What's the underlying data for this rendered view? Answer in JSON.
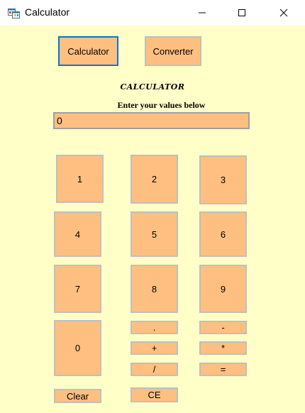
{
  "window": {
    "title": "Calculator"
  },
  "tabs": {
    "calculator": "Calculator",
    "converter": "Converter"
  },
  "heading": "CALCULATOR",
  "subheading": "Enter your values below",
  "display": {
    "value": "0"
  },
  "keys": {
    "k1": "1",
    "k2": "2",
    "k3": "3",
    "k4": "4",
    "k5": "5",
    "k6": "6",
    "k7": "7",
    "k8": "8",
    "k9": "9",
    "k0": "0",
    "dot": ".",
    "plus": "+",
    "divide": "/",
    "minus": "-",
    "multiply": "*",
    "equals": "=",
    "clear": "Clear",
    "ce": "CE"
  },
  "colors": {
    "background": "#ffffc8",
    "button": "#ffbf80",
    "focus": "#0078d7"
  }
}
